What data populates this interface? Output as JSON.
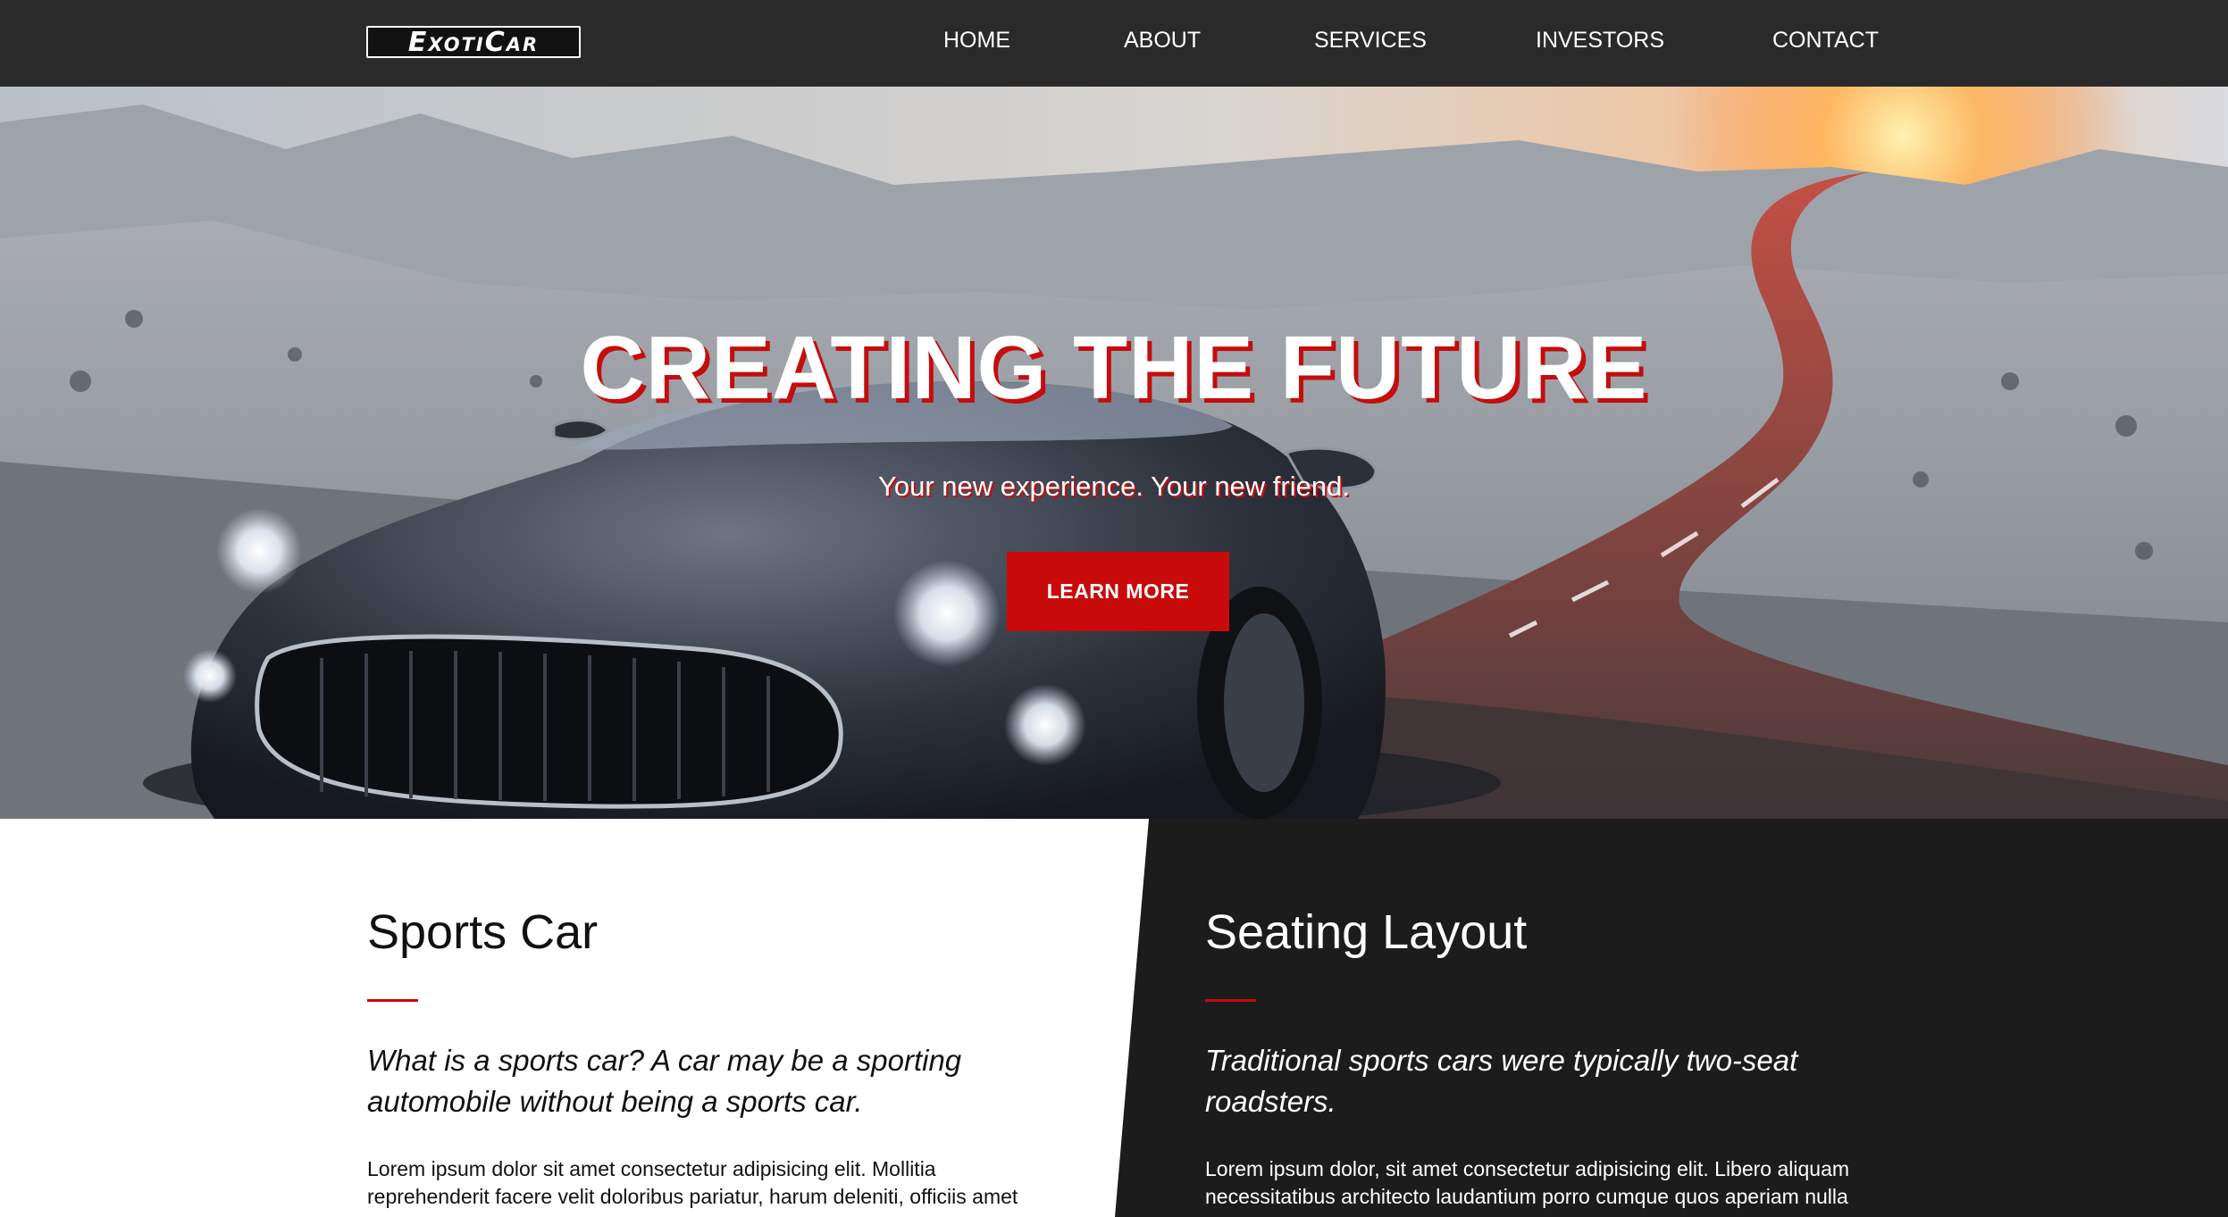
{
  "brand": {
    "logo_text": "ExotiCar"
  },
  "nav": {
    "items": [
      {
        "label": "HOME"
      },
      {
        "label": "ABOUT"
      },
      {
        "label": "SERVICES"
      },
      {
        "label": "INVESTORS"
      },
      {
        "label": "CONTACT"
      }
    ]
  },
  "hero": {
    "title": "CREATING THE FUTURE",
    "subtitle": "Your new experience. Your new friend.",
    "button_label": "LEARN MORE"
  },
  "sections": [
    {
      "title": "Sports Car",
      "lead": "What is a sports car? A car may be a sporting automobile without being a sports car.",
      "body": "Lorem ipsum dolor sit amet consectetur adipisicing elit. Mollitia reprehenderit facere velit doloribus pariatur, harum deleniti, officiis amet"
    },
    {
      "title": "Seating Layout",
      "lead": "Traditional sports cars were typically two-seat roadsters.",
      "body": "Lorem ipsum dolor, sit amet consectetur adipisicing elit. Libero aliquam necessitatibus architecto laudantium porro cumque quos aperiam nulla"
    }
  ],
  "colors": {
    "accent": "#c90a0a",
    "nav_bg": "#2a2a2a",
    "dark_panel": "#1c1c1c"
  }
}
